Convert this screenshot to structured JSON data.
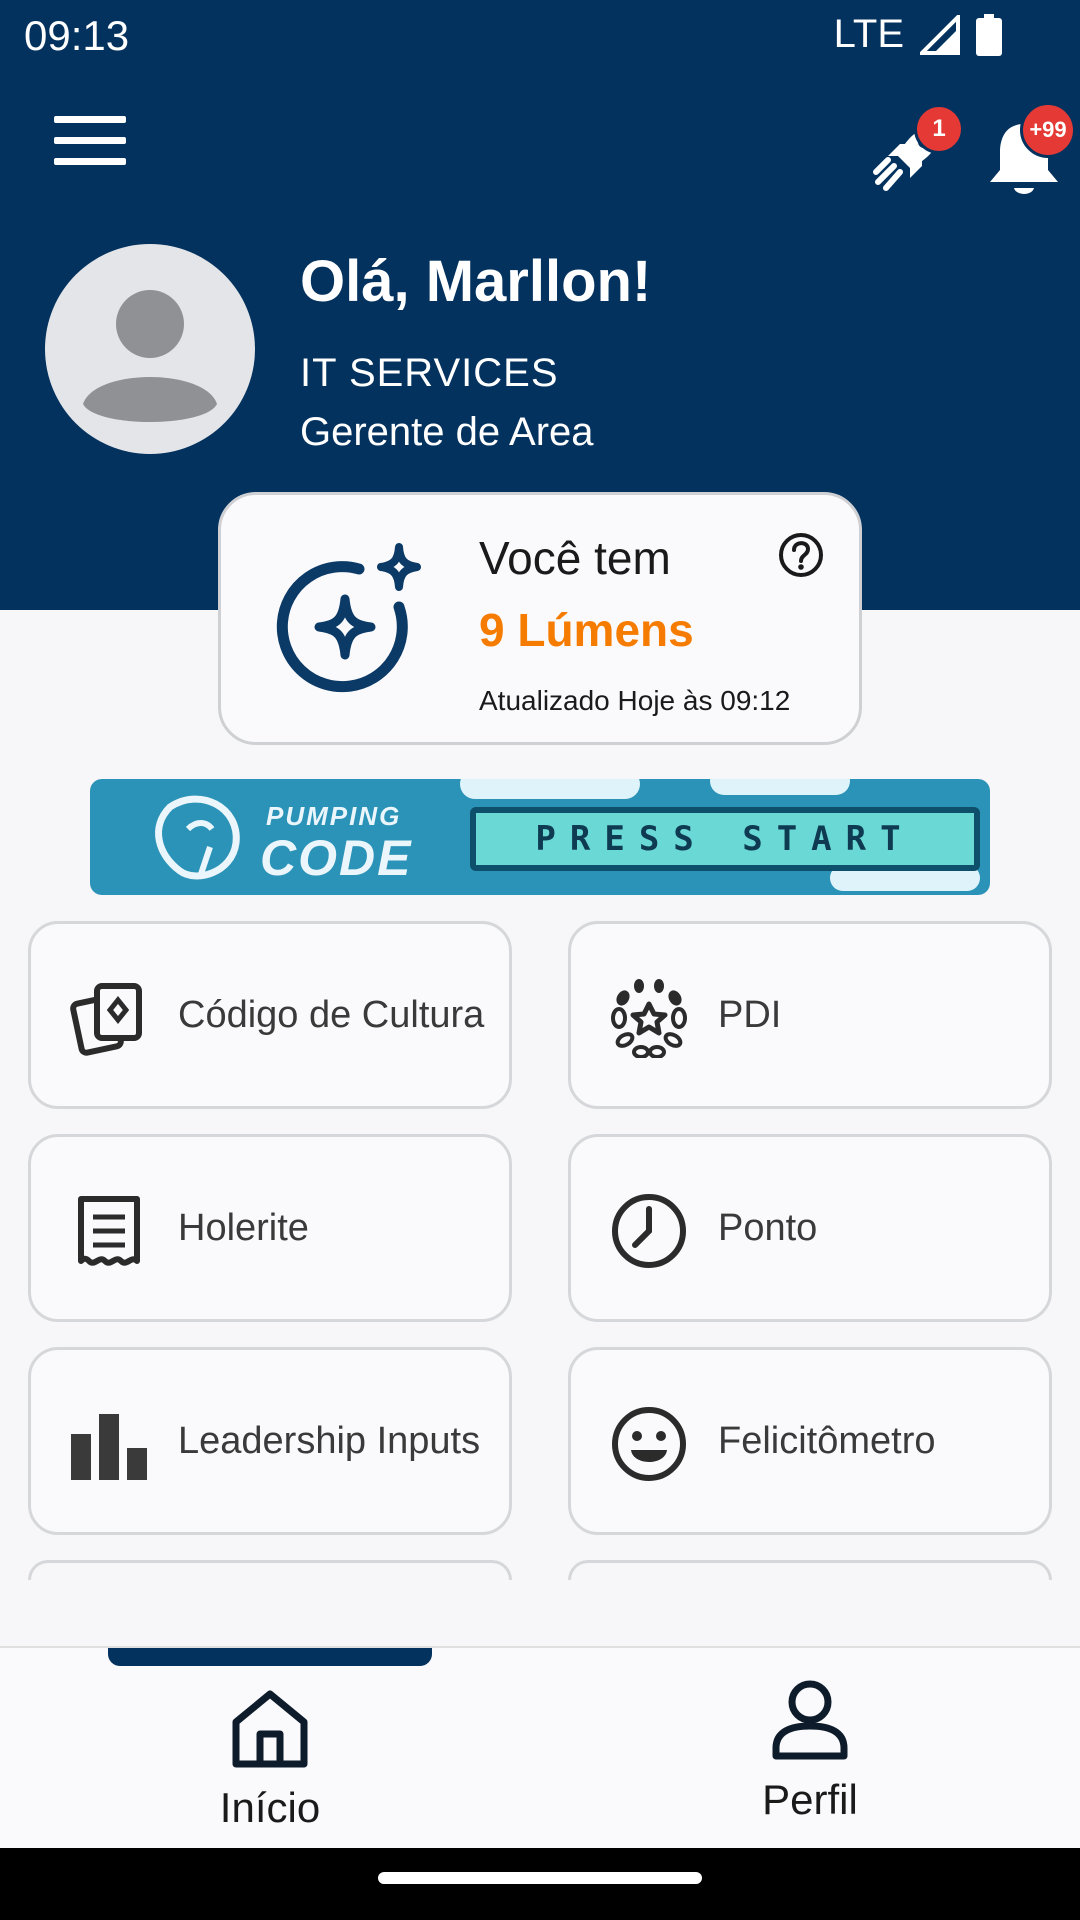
{
  "status_bar": {
    "time": "09:13",
    "network": "LTE"
  },
  "header": {
    "rocket_badge": "1",
    "notifications_badge": "+99",
    "greeting": "Olá, Marllon!",
    "department": "IT SERVICES",
    "role": "Gerente de Area"
  },
  "lumens": {
    "title": "Você tem",
    "value": "9 Lúmens",
    "updated": "Atualizado Hoje às 09:12"
  },
  "banner": {
    "logo_top": "PUMPING",
    "logo_bottom": "CODE",
    "press_start": "PRESS START"
  },
  "tiles": [
    {
      "label": "Código de Cultura",
      "icon": "culture-cards-icon"
    },
    {
      "label": "PDI",
      "icon": "laurel-star-icon"
    },
    {
      "label": "Holerite",
      "icon": "receipt-icon"
    },
    {
      "label": "Ponto",
      "icon": "clock-icon"
    },
    {
      "label": "Leadership Inputs",
      "icon": "bar-chart-icon"
    },
    {
      "label": "Felicitômetro",
      "icon": "smiley-icon"
    }
  ],
  "bottom_nav": [
    {
      "label": "Início",
      "icon": "home-icon",
      "active": true
    },
    {
      "label": "Perfil",
      "icon": "person-icon",
      "active": false
    }
  ],
  "colors": {
    "primary": "#03325e",
    "accent": "#f57c00",
    "badge": "#e53935"
  }
}
